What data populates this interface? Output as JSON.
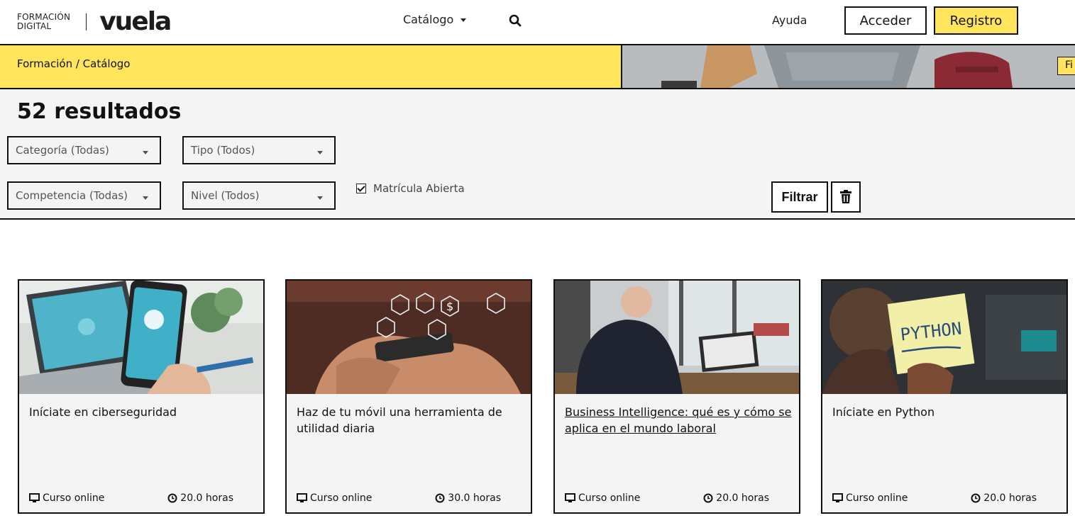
{
  "header": {
    "logo_small_line1": "FORMACIÓN",
    "logo_small_line2": "DIGITAL",
    "logo_brand": "vuela",
    "nav_catalog": "Catálogo",
    "nav_help": "Ayuda",
    "login_label": "Acceder",
    "register_label": "Registro"
  },
  "banner": {
    "breadcrumb": "Formación / Catálogo",
    "tag": "Fi"
  },
  "filters": {
    "results": "52 resultados",
    "category": "Categoría (Todas)",
    "type": "Tipo (Todos)",
    "competence": "Competencia (Todas)",
    "level": "Nivel (Todos)",
    "open_enrollment": "Matrícula Abierta",
    "filter_button": "Filtrar"
  },
  "cards": [
    {
      "title": "Iníciate en ciberseguridad",
      "mode": "Curso online",
      "hours": "20.0 horas"
    },
    {
      "title": "Haz de tu móvil una herramienta de utilidad diaria",
      "mode": "Curso online",
      "hours": "30.0 horas"
    },
    {
      "title": "Business Intelligence: qué es y cómo se aplica en el mundo laboral",
      "mode": "Curso online",
      "hours": "20.0 horas"
    },
    {
      "title": "Iníciate en Python",
      "mode": "Curso online",
      "hours": "20.0 horas",
      "note_text": "PYTHON"
    }
  ],
  "colors": {
    "accent_yellow": "#ffe45c",
    "border": "#111111",
    "panel": "#f4f4f4"
  }
}
